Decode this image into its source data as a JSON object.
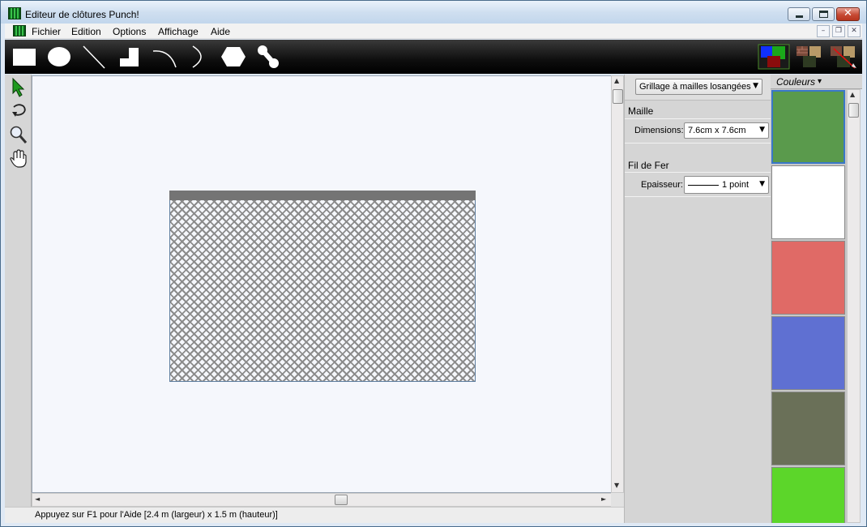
{
  "window": {
    "title": "Editeur de clôtures Punch!",
    "close_glyph": "✕"
  },
  "menu": {
    "items": [
      "Fichier",
      "Edition",
      "Options",
      "Affichage",
      "Aide"
    ],
    "mdi_buttons": [
      "–",
      "❐",
      "✕"
    ]
  },
  "toolbar": {
    "tools": [
      "rectangle-tool",
      "ellipse-tool",
      "line-tool",
      "corner-tool",
      "arc-tool",
      "half-arc-tool",
      "hexagon-tool",
      "bone-tool"
    ],
    "right_tools": [
      "colors-tool",
      "textures-tool",
      "remove-texture-tool"
    ]
  },
  "left_tools": [
    "select-arrow-icon",
    "rotate-icon",
    "zoom-icon",
    "hand-pan-icon"
  ],
  "canvas": {
    "arrows": {
      "up": "▲",
      "down": "▼",
      "left": "◄",
      "right": "►"
    }
  },
  "properties": {
    "type_value": "Grillage à mailles losangées",
    "arrow": "▼",
    "mesh_section": "Maille",
    "dimensions_label": "Dimensions:",
    "dimensions_value": "7.6cm x 7.6cm",
    "wire_section": "Fil de Fer",
    "thickness_label": "Epaisseur:",
    "thickness_value": "1 point"
  },
  "colors": {
    "header": "Couleurs",
    "header_arrow": "▾",
    "swatches": [
      "#5a9a4c",
      "#ffffff",
      "#e06a66",
      "#5f70d2",
      "#6a7058",
      "#5cd62a"
    ],
    "selected_index": 0
  },
  "status": {
    "text": "Appuyez sur F1 pour l'Aide [2.4 m (largeur) x 1.5 m (hauteur)]"
  }
}
